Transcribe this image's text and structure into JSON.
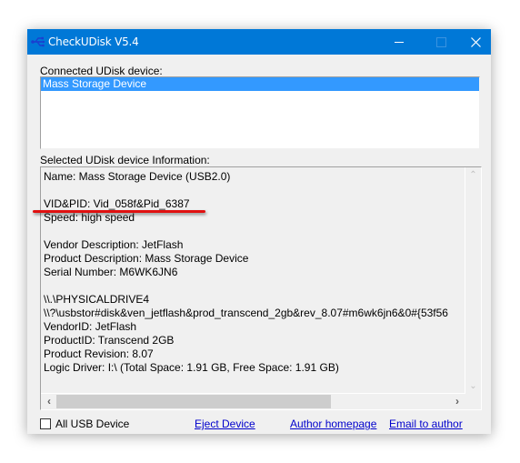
{
  "window": {
    "title": "CheckUDisk V5.4",
    "app_icon": "usb-icon",
    "controls": {
      "minimize": "minimize-icon",
      "maximize": "maximize-icon",
      "close": "close-icon"
    }
  },
  "connected": {
    "label": "Connected UDisk device:",
    "items": [
      {
        "label": "Mass Storage Device",
        "selected": true
      }
    ]
  },
  "selected_info": {
    "label": "Selected UDisk device Information:",
    "lines": [
      "Name: Mass Storage Device  (USB2.0)",
      "",
      "VID&PID: Vid_058f&Pid_6387",
      "Speed: high speed",
      "",
      "Vendor Description: JetFlash",
      "Product Description: Mass Storage Device",
      "Serial Number: M6WK6JN6",
      "",
      "\\\\.\\PHYSICALDRIVE4",
      "\\\\?\\usbstor#disk&ven_jetflash&prod_transcend_2gb&rev_8.07#m6wk6jn6&0#{53f56",
      "VendorID: JetFlash",
      "ProductID: Transcend 2GB",
      "Product Revision: 8.07",
      "Logic Driver: I:\\  (Total Space: 1.91 GB, Free Space: 1.91 GB)"
    ],
    "highlight_color": "#e01010"
  },
  "footer": {
    "all_usb_label": "All USB Device",
    "all_usb_checked": false,
    "eject_label": "Eject Device",
    "homepage_label": "Author homepage",
    "email_label": "Email to author"
  },
  "colors": {
    "titlebar": "#0078d7",
    "selection": "#3399ff",
    "link": "#0000cc",
    "window_bg": "#f0f0f0"
  }
}
